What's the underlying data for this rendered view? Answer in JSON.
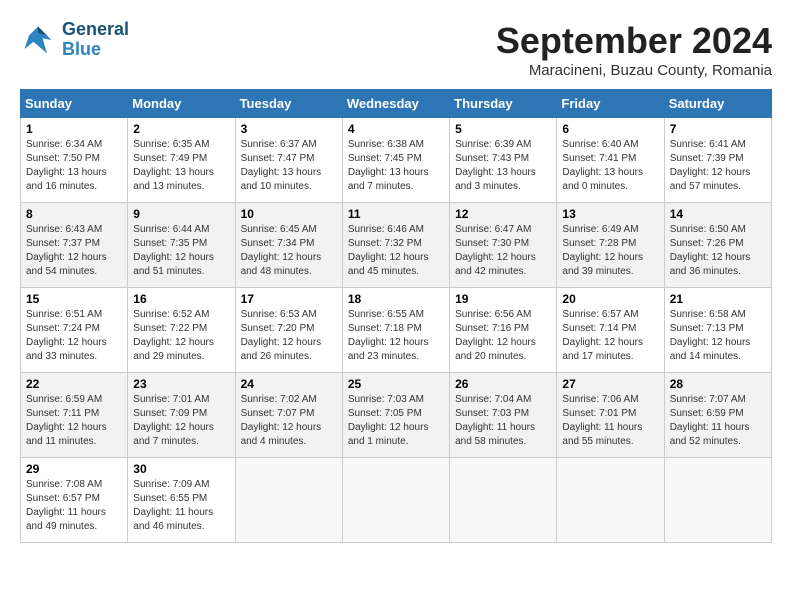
{
  "header": {
    "logo_line1": "General",
    "logo_line2": "Blue",
    "month": "September 2024",
    "location": "Maracineni, Buzau County, Romania"
  },
  "weekdays": [
    "Sunday",
    "Monday",
    "Tuesday",
    "Wednesday",
    "Thursday",
    "Friday",
    "Saturday"
  ],
  "weeks": [
    [
      {
        "day": "1",
        "info": "Sunrise: 6:34 AM\nSunset: 7:50 PM\nDaylight: 13 hours\nand 16 minutes."
      },
      {
        "day": "2",
        "info": "Sunrise: 6:35 AM\nSunset: 7:49 PM\nDaylight: 13 hours\nand 13 minutes."
      },
      {
        "day": "3",
        "info": "Sunrise: 6:37 AM\nSunset: 7:47 PM\nDaylight: 13 hours\nand 10 minutes."
      },
      {
        "day": "4",
        "info": "Sunrise: 6:38 AM\nSunset: 7:45 PM\nDaylight: 13 hours\nand 7 minutes."
      },
      {
        "day": "5",
        "info": "Sunrise: 6:39 AM\nSunset: 7:43 PM\nDaylight: 13 hours\nand 3 minutes."
      },
      {
        "day": "6",
        "info": "Sunrise: 6:40 AM\nSunset: 7:41 PM\nDaylight: 13 hours\nand 0 minutes."
      },
      {
        "day": "7",
        "info": "Sunrise: 6:41 AM\nSunset: 7:39 PM\nDaylight: 12 hours\nand 57 minutes."
      }
    ],
    [
      {
        "day": "8",
        "info": "Sunrise: 6:43 AM\nSunset: 7:37 PM\nDaylight: 12 hours\nand 54 minutes."
      },
      {
        "day": "9",
        "info": "Sunrise: 6:44 AM\nSunset: 7:35 PM\nDaylight: 12 hours\nand 51 minutes."
      },
      {
        "day": "10",
        "info": "Sunrise: 6:45 AM\nSunset: 7:34 PM\nDaylight: 12 hours\nand 48 minutes."
      },
      {
        "day": "11",
        "info": "Sunrise: 6:46 AM\nSunset: 7:32 PM\nDaylight: 12 hours\nand 45 minutes."
      },
      {
        "day": "12",
        "info": "Sunrise: 6:47 AM\nSunset: 7:30 PM\nDaylight: 12 hours\nand 42 minutes."
      },
      {
        "day": "13",
        "info": "Sunrise: 6:49 AM\nSunset: 7:28 PM\nDaylight: 12 hours\nand 39 minutes."
      },
      {
        "day": "14",
        "info": "Sunrise: 6:50 AM\nSunset: 7:26 PM\nDaylight: 12 hours\nand 36 minutes."
      }
    ],
    [
      {
        "day": "15",
        "info": "Sunrise: 6:51 AM\nSunset: 7:24 PM\nDaylight: 12 hours\nand 33 minutes."
      },
      {
        "day": "16",
        "info": "Sunrise: 6:52 AM\nSunset: 7:22 PM\nDaylight: 12 hours\nand 29 minutes."
      },
      {
        "day": "17",
        "info": "Sunrise: 6:53 AM\nSunset: 7:20 PM\nDaylight: 12 hours\nand 26 minutes."
      },
      {
        "day": "18",
        "info": "Sunrise: 6:55 AM\nSunset: 7:18 PM\nDaylight: 12 hours\nand 23 minutes."
      },
      {
        "day": "19",
        "info": "Sunrise: 6:56 AM\nSunset: 7:16 PM\nDaylight: 12 hours\nand 20 minutes."
      },
      {
        "day": "20",
        "info": "Sunrise: 6:57 AM\nSunset: 7:14 PM\nDaylight: 12 hours\nand 17 minutes."
      },
      {
        "day": "21",
        "info": "Sunrise: 6:58 AM\nSunset: 7:13 PM\nDaylight: 12 hours\nand 14 minutes."
      }
    ],
    [
      {
        "day": "22",
        "info": "Sunrise: 6:59 AM\nSunset: 7:11 PM\nDaylight: 12 hours\nand 11 minutes."
      },
      {
        "day": "23",
        "info": "Sunrise: 7:01 AM\nSunset: 7:09 PM\nDaylight: 12 hours\nand 7 minutes."
      },
      {
        "day": "24",
        "info": "Sunrise: 7:02 AM\nSunset: 7:07 PM\nDaylight: 12 hours\nand 4 minutes."
      },
      {
        "day": "25",
        "info": "Sunrise: 7:03 AM\nSunset: 7:05 PM\nDaylight: 12 hours\nand 1 minute."
      },
      {
        "day": "26",
        "info": "Sunrise: 7:04 AM\nSunset: 7:03 PM\nDaylight: 11 hours\nand 58 minutes."
      },
      {
        "day": "27",
        "info": "Sunrise: 7:06 AM\nSunset: 7:01 PM\nDaylight: 11 hours\nand 55 minutes."
      },
      {
        "day": "28",
        "info": "Sunrise: 7:07 AM\nSunset: 6:59 PM\nDaylight: 11 hours\nand 52 minutes."
      }
    ],
    [
      {
        "day": "29",
        "info": "Sunrise: 7:08 AM\nSunset: 6:57 PM\nDaylight: 11 hours\nand 49 minutes."
      },
      {
        "day": "30",
        "info": "Sunrise: 7:09 AM\nSunset: 6:55 PM\nDaylight: 11 hours\nand 46 minutes."
      },
      {
        "day": "",
        "info": ""
      },
      {
        "day": "",
        "info": ""
      },
      {
        "day": "",
        "info": ""
      },
      {
        "day": "",
        "info": ""
      },
      {
        "day": "",
        "info": ""
      }
    ]
  ]
}
